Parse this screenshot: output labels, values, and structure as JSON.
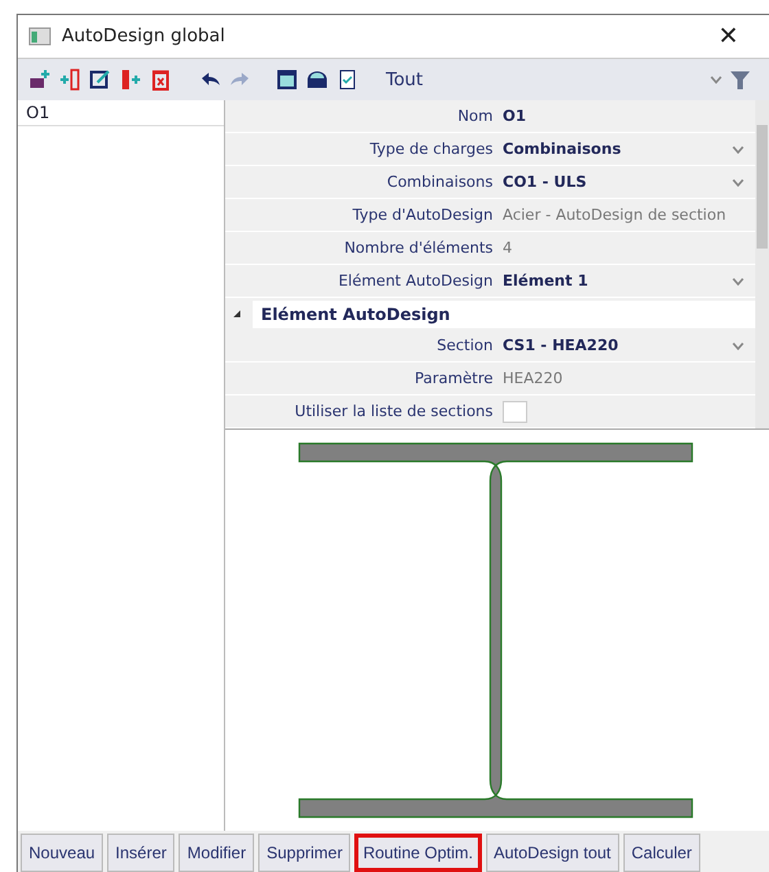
{
  "window": {
    "title": "AutoDesign global",
    "close": "✕"
  },
  "toolbar": {
    "filter_value": "Tout"
  },
  "list": {
    "items": [
      {
        "label": "O1",
        "selected": false
      }
    ]
  },
  "properties": [
    {
      "kind": "field",
      "label": "Nom",
      "value": "O1",
      "bold": true,
      "dropdown": false
    },
    {
      "kind": "field",
      "label": "Type de charges",
      "value": "Combinaisons",
      "bold": true,
      "dropdown": true
    },
    {
      "kind": "field",
      "label": "Combinaisons",
      "value": "CO1 - ULS",
      "bold": true,
      "dropdown": true
    },
    {
      "kind": "field",
      "label": "Type d'AutoDesign",
      "value": "Acier - AutoDesign de section",
      "bold": false,
      "dropdown": false
    },
    {
      "kind": "field",
      "label": "Nombre d'éléments",
      "value": "4",
      "bold": false,
      "dropdown": false
    },
    {
      "kind": "field",
      "label": "Elément AutoDesign",
      "value": "Elément 1",
      "bold": true,
      "dropdown": true
    },
    {
      "kind": "group",
      "label": "Elément AutoDesign",
      "expanded": true
    },
    {
      "kind": "field",
      "label": "Section",
      "value": "CS1 - HEA220",
      "bold": true,
      "dropdown": true
    },
    {
      "kind": "field",
      "label": "Paramètre",
      "value": "HEA220",
      "bold": false,
      "dropdown": false
    },
    {
      "kind": "checkbox",
      "label": "Utiliser la liste de sections",
      "checked": false
    }
  ],
  "buttons": [
    {
      "label": "Nouveau",
      "highlighted": false
    },
    {
      "label": "Insérer",
      "highlighted": false
    },
    {
      "label": "Modifier",
      "highlighted": false
    },
    {
      "label": "Supprimer",
      "highlighted": false
    },
    {
      "label": "Routine Optim.",
      "highlighted": true
    },
    {
      "label": "AutoDesign tout",
      "highlighted": false
    },
    {
      "label": "Calculer",
      "highlighted": false
    }
  ]
}
